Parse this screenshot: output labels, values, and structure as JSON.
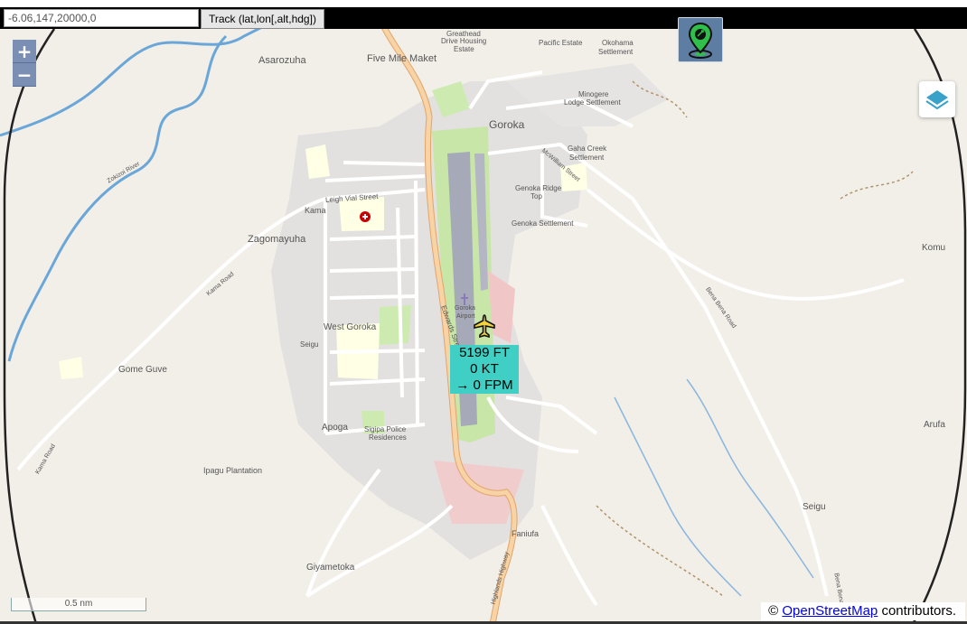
{
  "toolbar": {
    "coord_value": "-6.06,147,20000,0",
    "track_label": "Track (lat,lon[,alt,hdg])"
  },
  "map": {
    "zoom_in": "+",
    "zoom_out": "−",
    "labels": {
      "five_mile": "Five Mile Maket",
      "asarozuha": "Asarozuha",
      "greathead": "Greathead",
      "greathead2": "Drive Housing",
      "greathead3": "Estate",
      "pacific": "Pacific Estate",
      "okohama": "Okohama",
      "okohama2": "Settlement",
      "minogere": "Minogere",
      "minogere2": "Lodge Settlement",
      "goroka": "Goroka",
      "gaha": "Gaha Creek",
      "gaha2": "Settlement",
      "genoka_ridge": "Genoka Ridge",
      "genoka_ridge2": "Top",
      "genoka_sett": "Genoka Settlement",
      "zagomayuha": "Zagomayuha",
      "kama": "Kama",
      "west_goroka": "West Goroka",
      "seigu_w": "Seigu",
      "gome_guve": "Gome Guve",
      "apoga": "Apoga",
      "sigipa": "Sigipa Police",
      "sigipa2": "Residences",
      "ipagu": "Ipagu Plantation",
      "giyametoka": "Giyametoka",
      "faniufa": "Faniufa",
      "komu": "Komu",
      "arufa": "Arufa",
      "seigu_e": "Seigu",
      "edwards": "Edwards Street",
      "leigh_vial": "Leigh Vial Street",
      "kama_road": "Kama Road",
      "kama_road2": "Kama Road",
      "bena_road": "Bena Bena Road",
      "bena_road2": "Bena Bena",
      "highway": "Highlands Highway",
      "mcwilliam": "McWilliam Street",
      "airport": "Goroka",
      "airport2": "Airport",
      "zokizoi": "Zokizoi River"
    },
    "info": {
      "altitude": "5199 FT",
      "speed": "0 KT",
      "vsi": "→ 0 FPM"
    },
    "scale_label": "0.5 nm",
    "attribution_prefix": "©",
    "attribution_link": "OpenStreetMap",
    "attribution_suffix": "contributors."
  },
  "colors": {
    "land": "#f2efe9",
    "urban": "#e0dfdf",
    "road_major": "#f5c38b",
    "runway": "#a6a9b7",
    "airfield_green": "#c8e6a8",
    "water": "#6aa7d8",
    "info_bg": "#3fcfc4"
  },
  "icons": {
    "locate": "location-pin-icon",
    "layers": "layers-icon",
    "aircraft": "airplane-icon"
  }
}
